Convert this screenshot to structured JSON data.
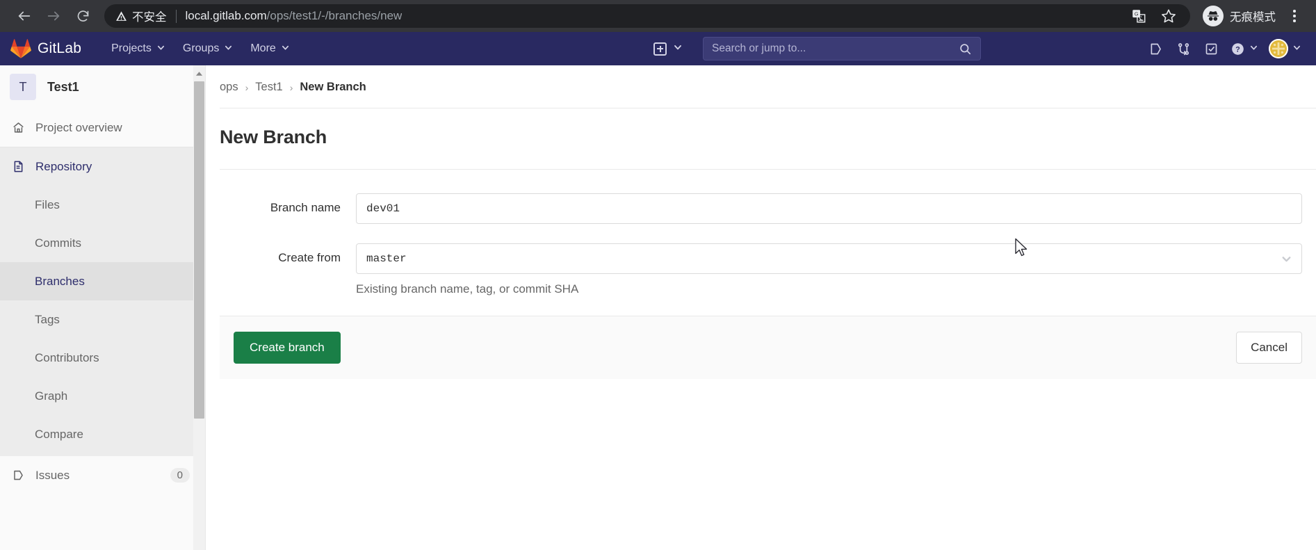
{
  "browser": {
    "back_icon": "back-arrow-icon",
    "forward_icon": "forward-arrow-icon",
    "reload_icon": "reload-icon",
    "security_warning": "不安全",
    "url_host": "local.gitlab.com",
    "url_path": "/ops/test1/-/branches/new",
    "translate_icon": "translate-icon",
    "bookmark_icon": "star-icon",
    "incognito_label": "无痕模式",
    "menu_icon": "kebab-menu-icon"
  },
  "navbar": {
    "brand": "GitLab",
    "logo_icon": "gitlab-tanuki-logo",
    "menu": [
      {
        "label": "Projects"
      },
      {
        "label": "Groups"
      },
      {
        "label": "More"
      }
    ],
    "create_new_icon": "plus-square-icon",
    "search": {
      "placeholder": "Search or jump to...",
      "value": "",
      "icon": "search-icon"
    },
    "icons": [
      {
        "name": "issues-icon"
      },
      {
        "name": "merge-requests-icon"
      },
      {
        "name": "todos-icon"
      },
      {
        "name": "help-icon"
      }
    ],
    "avatar_icon": "user-avatar",
    "accent": "#292961"
  },
  "sidebar": {
    "project": {
      "initial": "T",
      "name": "Test1"
    },
    "items": [
      {
        "label": "Project overview",
        "icon": "home-icon",
        "state": "normal"
      },
      {
        "label": "Repository",
        "icon": "document-icon",
        "state": "active-section"
      }
    ],
    "repository_children": [
      {
        "label": "Files",
        "state": "normal"
      },
      {
        "label": "Commits",
        "state": "normal"
      },
      {
        "label": "Branches",
        "state": "active"
      },
      {
        "label": "Tags",
        "state": "normal"
      },
      {
        "label": "Contributors",
        "state": "normal"
      },
      {
        "label": "Graph",
        "state": "normal"
      },
      {
        "label": "Compare",
        "state": "normal"
      }
    ],
    "issues": {
      "label": "Issues",
      "icon": "issues-icon",
      "count": "0"
    },
    "scrollbar": {
      "up_arrow_icon": "scroll-up-arrow-icon"
    }
  },
  "breadcrumb": {
    "group": "ops",
    "project": "Test1",
    "page": "New Branch",
    "separator": "›"
  },
  "page": {
    "title": "New Branch"
  },
  "form": {
    "branch_name": {
      "label": "Branch name",
      "value": "dev01",
      "placeholder": ""
    },
    "create_from": {
      "label": "Create from",
      "value": "master",
      "helper": "Existing branch name, tag, or commit SHA",
      "chevron_icon": "chevron-down-icon"
    },
    "submit_label": "Create branch",
    "cancel_label": "Cancel",
    "submit_color": "#1a7f47"
  }
}
